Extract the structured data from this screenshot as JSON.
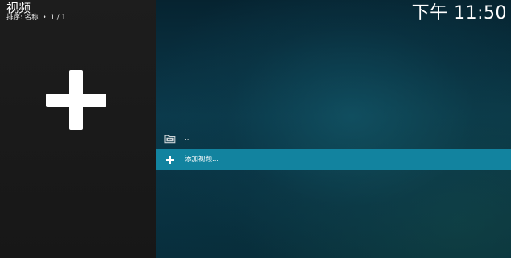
{
  "header": {
    "title": "视频",
    "sort_label": "排序: 名称",
    "separator": "•",
    "page_counter": "1 / 1"
  },
  "clock": {
    "time": "下午 11:50"
  },
  "list": {
    "items": [
      {
        "label": "..",
        "icon": "folder-back-icon",
        "selected": false
      },
      {
        "label": "添加视频...",
        "icon": "plus-icon",
        "selected": true
      }
    ]
  },
  "left_panel": {
    "icon": "plus-icon"
  },
  "colors": {
    "highlight": "#12839f",
    "left_panel": "#1b1b1b",
    "background": "#0b3a4c"
  }
}
